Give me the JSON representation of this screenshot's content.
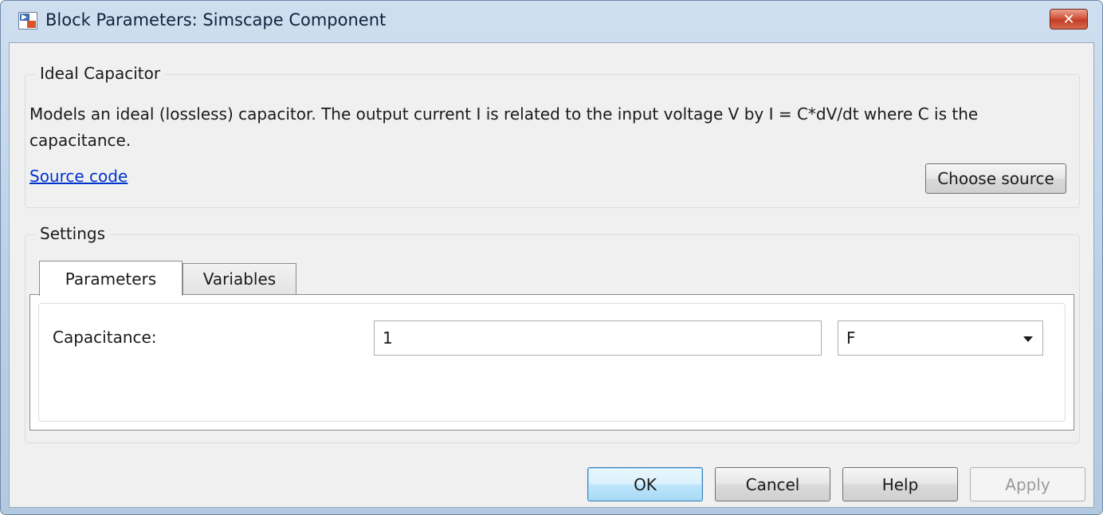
{
  "window": {
    "title": "Block Parameters: Simscape Component",
    "close_label": "✕"
  },
  "description_group": {
    "title": "Ideal Capacitor",
    "text": "Models an ideal (lossless) capacitor. The output current I is related to the input voltage V by I = C*dV/dt where C is the capacitance.",
    "source_link": "Source code",
    "choose_source_label": "Choose source"
  },
  "settings_group": {
    "title": "Settings",
    "tabs": [
      {
        "label": "Parameters",
        "active": true
      },
      {
        "label": "Variables",
        "active": false
      }
    ],
    "parameters": [
      {
        "label": "Capacitance:",
        "value": "1",
        "unit": "F"
      }
    ]
  },
  "buttons": {
    "ok": "OK",
    "cancel": "Cancel",
    "help": "Help",
    "apply": "Apply"
  },
  "icons": {
    "app": "simulink-block-icon",
    "close": "close-icon",
    "dropdown": "chevron-down-icon"
  }
}
